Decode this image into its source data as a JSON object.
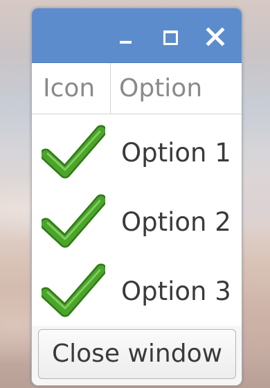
{
  "window": {
    "titlebar": {
      "title": "",
      "color": "#5d8ccd",
      "buttons": [
        {
          "name": "minimize",
          "icon": "minimize-icon"
        },
        {
          "name": "maximize",
          "icon": "maximize-icon"
        },
        {
          "name": "close",
          "icon": "close-icon"
        }
      ]
    },
    "tree": {
      "columns": [
        "Icon",
        "Option"
      ],
      "rows": [
        {
          "icon": "green-checkmark-icon",
          "label": "Option 1"
        },
        {
          "icon": "green-checkmark-icon",
          "label": "Option 2"
        },
        {
          "icon": "green-checkmark-icon",
          "label": "Option 3"
        }
      ]
    },
    "footer": {
      "close_button_label": "Close window"
    }
  },
  "colors": {
    "check_green": "#4aa52a",
    "check_outline": "#2f7a16"
  }
}
